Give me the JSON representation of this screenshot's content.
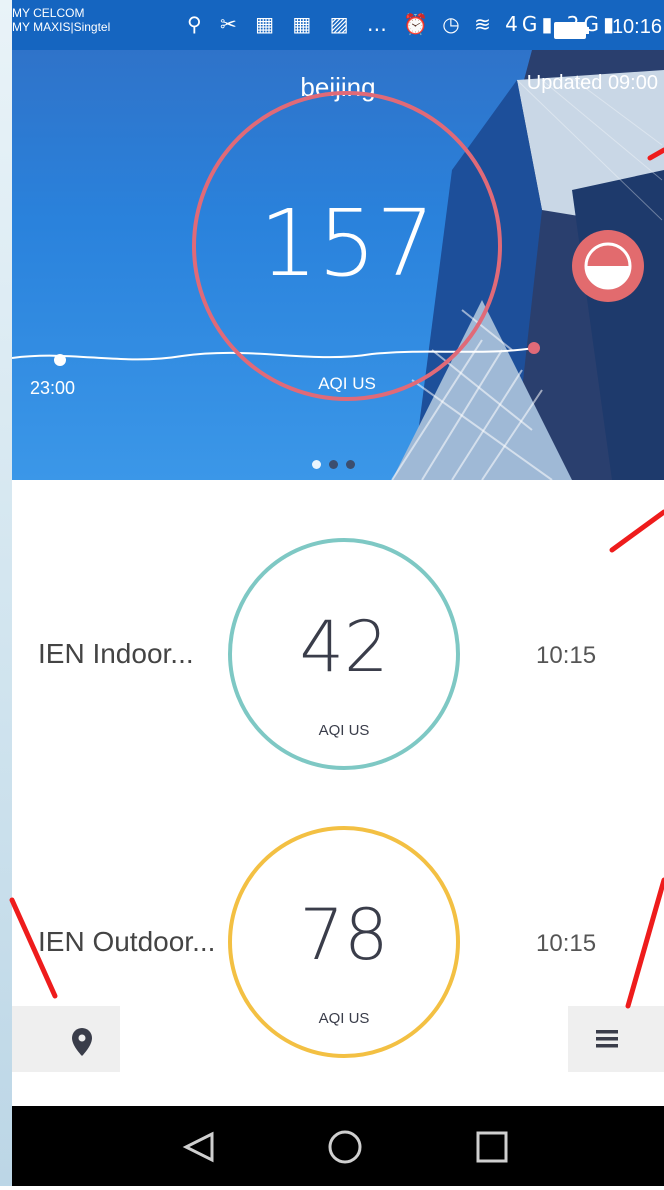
{
  "status_bar": {
    "carrier_1": "MY CELCOM",
    "carrier_2": "MY MAXIS|Singtel",
    "left_icons": "⚲ ✂ ▦ ▦ ▨ …",
    "right_icons": "⏰ ◷ ≋ 4G▮ 2G▮",
    "time": "10:16"
  },
  "hero": {
    "city": "beijing",
    "updated": "Updated 09:00",
    "aqi_value": "157",
    "aqi_unit": "AQI US",
    "timeline_label": "23:00",
    "ring_color": "#e06a78",
    "mask_button_icon": "face-mask-icon",
    "page_indicator_count": 3,
    "page_indicator_active": 0
  },
  "stations": [
    {
      "name": "IEN Indoor...",
      "value": "42",
      "unit": "AQI US",
      "time": "10:15",
      "ring_color": "#7ec8c4"
    },
    {
      "name": "IEN Outdoor...",
      "value": "78",
      "unit": "AQI US",
      "time": "10:15",
      "ring_color": "#f3c043"
    }
  ],
  "bottom_bar": {
    "location_icon": "location-pin-icon",
    "menu_icon": "hamburger-menu-icon"
  },
  "nav_bar": {
    "back_icon": "back-triangle-icon",
    "home_icon": "home-circle-icon",
    "recents_icon": "recents-square-icon"
  },
  "annotation_color": "#ee1c1c"
}
